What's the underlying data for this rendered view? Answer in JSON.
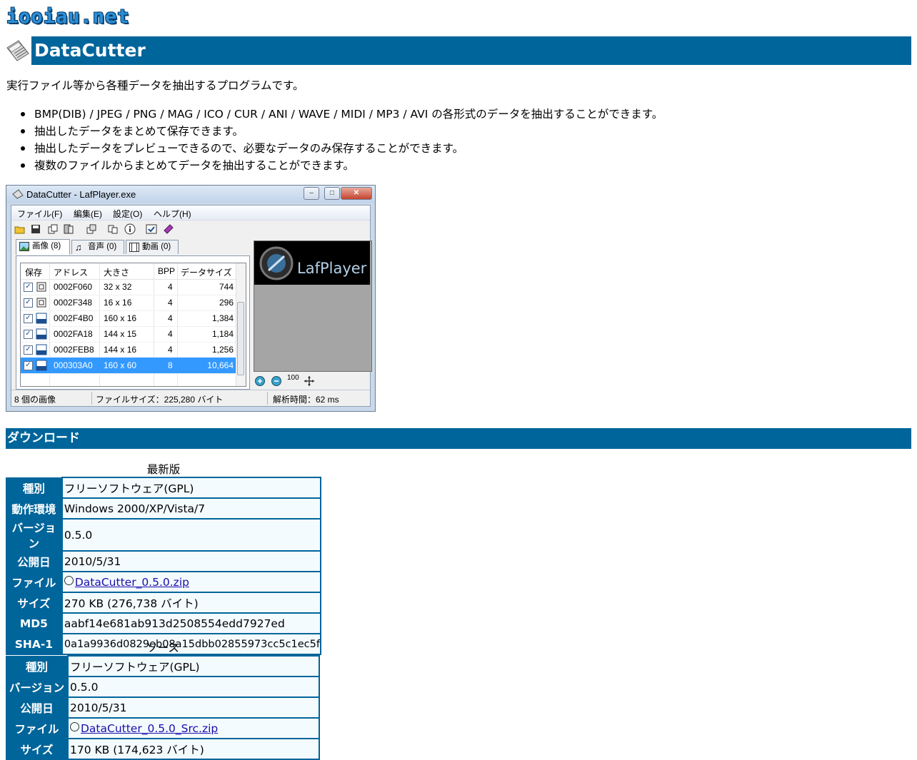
{
  "site": {
    "logo": "iooiau.net"
  },
  "page": {
    "title": "DataCutter",
    "intro": "実行ファイル等から各種データを抽出するプログラムです。",
    "features": [
      "BMP(DIB) / JPEG / PNG / MAG / ICO / CUR / ANI / WAVE / MIDI / MP3 / AVI の各形式のデータを抽出することができます。",
      "抽出したデータをまとめて保存できます。",
      "抽出したデータをプレビューできるので、必要なデータのみ保存することができます。",
      "複数のファイルからまとめてデータを抽出することができます。"
    ]
  },
  "screenshot": {
    "window_title": "DataCutter - LafPlayer.exe",
    "menu": [
      "ファイル(F)",
      "編集(E)",
      "設定(O)",
      "ヘルプ(H)"
    ],
    "tabs": [
      "画像 (8)",
      "音声 (0)",
      "動画 (0)"
    ],
    "columns": [
      "保存",
      "アドレス",
      "大きさ",
      "BPP",
      "データサイズ"
    ],
    "rows": [
      {
        "address": "0002F060",
        "size": "32 x 32",
        "bpp": "4",
        "data_size": "744",
        "kind": "ico-icon"
      },
      {
        "address": "0002F348",
        "size": "16 x 16",
        "bpp": "4",
        "data_size": "296",
        "kind": "ico-icon"
      },
      {
        "address": "0002F4B0",
        "size": "160 x 16",
        "bpp": "4",
        "data_size": "1,384",
        "kind": "bmp-icon"
      },
      {
        "address": "0002FA18",
        "size": "144 x 15",
        "bpp": "4",
        "data_size": "1,184",
        "kind": "bmp-icon"
      },
      {
        "address": "0002FEB8",
        "size": "144 x 16",
        "bpp": "4",
        "data_size": "1,256",
        "kind": "bmp-icon"
      },
      {
        "address": "000303A0",
        "size": "160 x 60",
        "bpp": "8",
        "data_size": "10,664",
        "kind": "bmp-icon",
        "selected": true
      }
    ],
    "preview_logo": "LafPlayer",
    "zoom_label": "100",
    "status": [
      "8 個の画像",
      "ファイルサイズ：225,280 バイト",
      "解析時間：62 ms"
    ]
  },
  "download": {
    "heading": "ダウンロード",
    "latest": {
      "caption": "最新版",
      "rows": [
        {
          "label": "種別",
          "value": "フリーソフトウェア(GPL)"
        },
        {
          "label": "動作環境",
          "value": "Windows 2000/XP/Vista/7"
        },
        {
          "label": "バージョン",
          "value": "0.5.0"
        },
        {
          "label": "公開日",
          "value": "2010/5/31"
        },
        {
          "label": "ファイル",
          "value": "DataCutter_0.5.0.zip",
          "link": true
        },
        {
          "label": "サイズ",
          "value": "270 KB (276,738 バイト)"
        },
        {
          "label": "MD5",
          "value": "aabf14e681ab913d2508554edd7927ed"
        },
        {
          "label": "SHA-1",
          "value": "0a1a9936d0829eb08a15dbb02855973cc5c1ec5f"
        }
      ]
    },
    "source": {
      "caption": "ソース",
      "rows": [
        {
          "label": "種別",
          "value": "フリーソフトウェア(GPL)"
        },
        {
          "label": "バージョン",
          "value": "0.5.0"
        },
        {
          "label": "公開日",
          "value": "2010/5/31"
        },
        {
          "label": "ファイル",
          "value": "DataCutter_0.5.0_Src.zip",
          "link": true
        },
        {
          "label": "サイズ",
          "value": "170 KB (174,623 バイト)"
        }
      ]
    }
  }
}
